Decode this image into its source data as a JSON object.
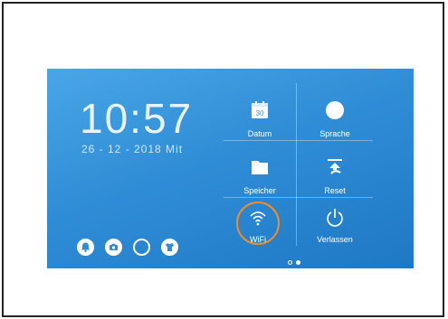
{
  "clock": {
    "time": "10:57",
    "date": "26 - 12 - 2018 Mit"
  },
  "tiles": [
    {
      "label": "Datum",
      "icon": "calendar-icon",
      "day": "30"
    },
    {
      "label": "Sprache",
      "icon": "circle-icon"
    },
    {
      "label": "Speicher",
      "icon": "folder-icon"
    },
    {
      "label": "Reset",
      "icon": "reset-icon"
    },
    {
      "label": "WiFi",
      "icon": "wifi-icon"
    },
    {
      "label": "Verlassen",
      "icon": "power-icon"
    }
  ],
  "pager": {
    "pages": 2,
    "current": 2
  },
  "bottom_icons": [
    "bell-icon",
    "camera-icon",
    "empty-circle-icon",
    "shirt-icon"
  ],
  "colors": {
    "screen_top": "#4aa6e6",
    "screen_bottom": "#1f78c4",
    "highlight": "#f28c28"
  }
}
